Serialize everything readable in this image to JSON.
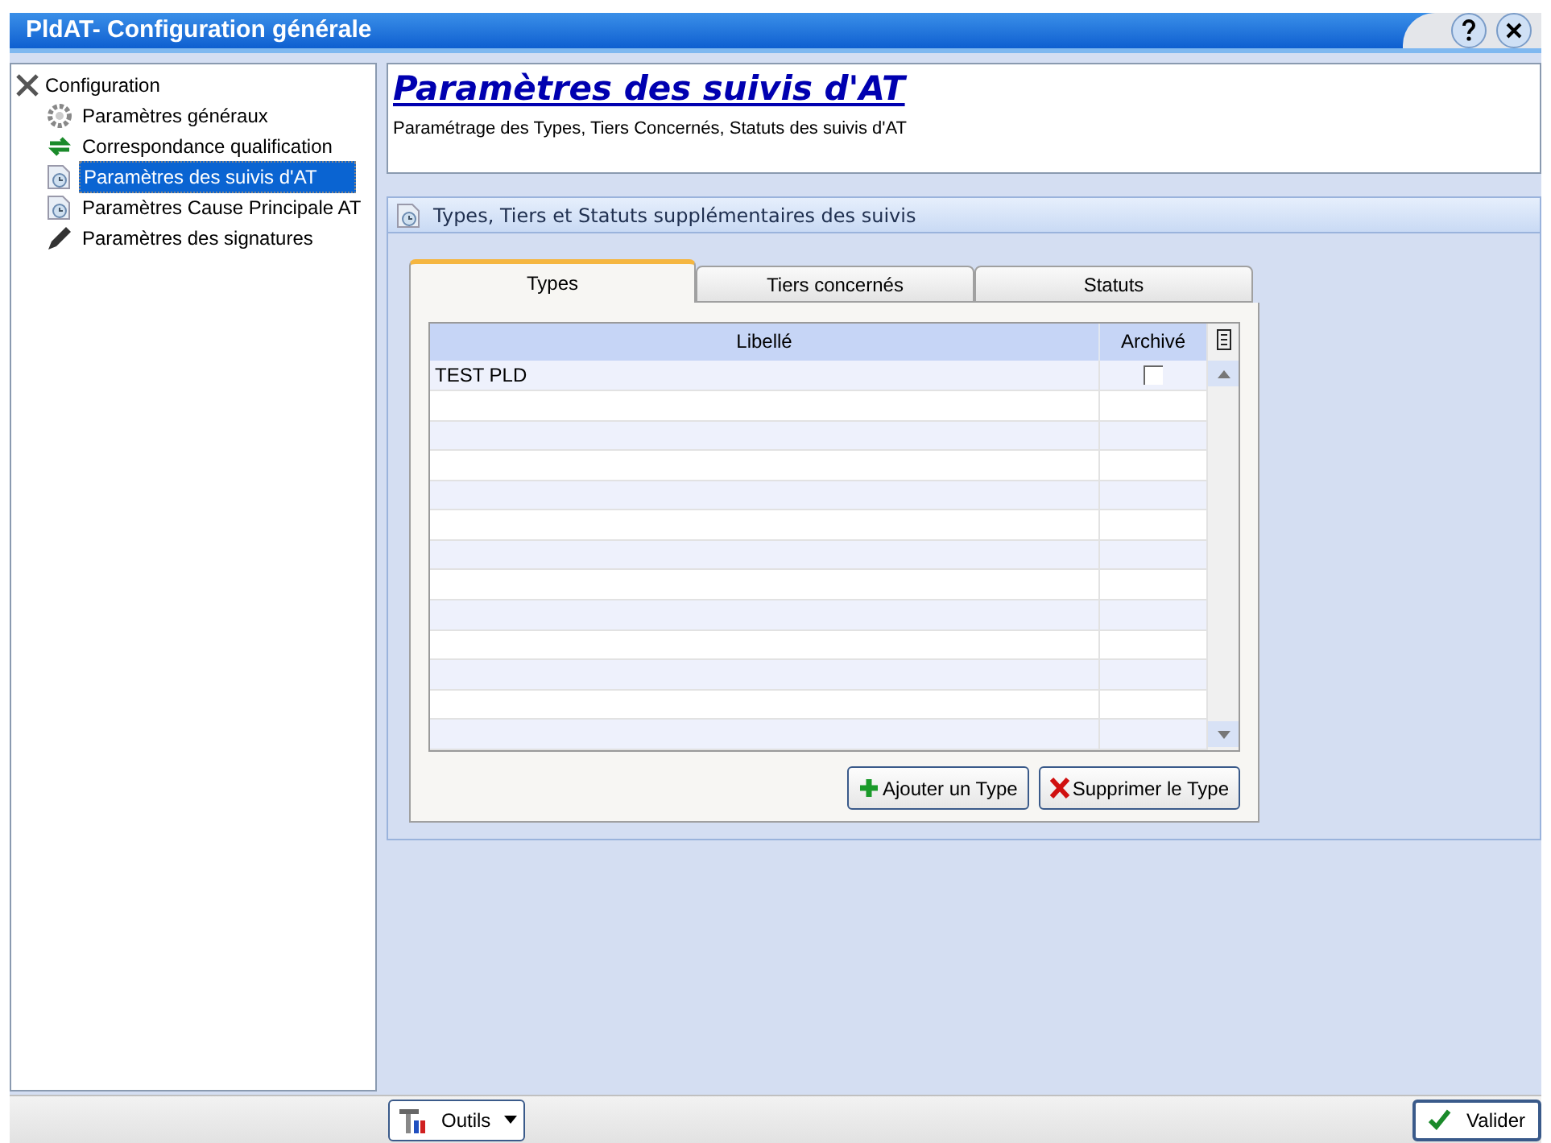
{
  "window": {
    "title": "PldAT- Configuration générale"
  },
  "tree": {
    "label": "Configuration",
    "children": [
      {
        "label": "Paramètres généraux",
        "kind": "gear",
        "selected": false
      },
      {
        "label": "Correspondance qualification",
        "kind": "arrows",
        "selected": false
      },
      {
        "label": "Paramètres des suivis d'AT",
        "kind": "clock",
        "selected": true
      },
      {
        "label": "Paramètres Cause Principale AT",
        "kind": "clock",
        "selected": false
      },
      {
        "label": "Paramètres des signatures",
        "kind": "pen",
        "selected": false
      }
    ]
  },
  "header": {
    "title": "Paramètres des suivis d'AT",
    "subtitle": "Paramétrage des Types, Tiers Concernés, Statuts des suivis d'AT"
  },
  "section": {
    "title": "Types, Tiers et Statuts supplémentaires des suivis",
    "tabs": [
      {
        "label": "Types",
        "selected": true
      },
      {
        "label": "Tiers concernés",
        "selected": false
      },
      {
        "label": "Statuts",
        "selected": false
      }
    ],
    "table": {
      "columns": [
        "Libellé",
        "Archivé"
      ],
      "rows": [
        {
          "label": "TEST PLD",
          "archived": false
        }
      ]
    },
    "buttons": [
      {
        "label": "Ajouter un Type",
        "kind": "add"
      },
      {
        "label": "Supprimer le Type",
        "kind": "delete"
      }
    ]
  },
  "footer": {
    "tools": "Outils",
    "validate": "Valider"
  }
}
